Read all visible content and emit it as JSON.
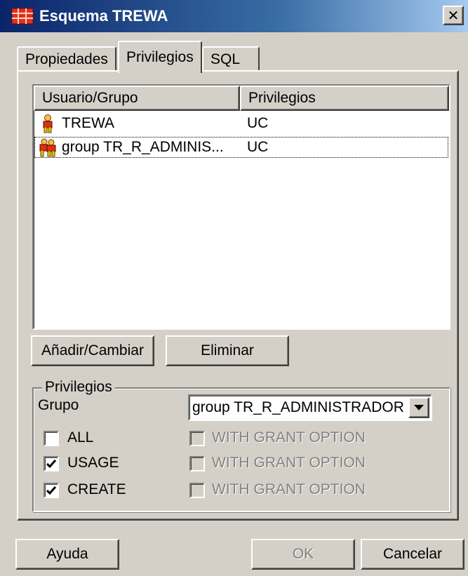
{
  "window": {
    "title": "Esquema TREWA",
    "close_glyph": "✕"
  },
  "tabs": [
    {
      "label": "Propiedades"
    },
    {
      "label": "Privilegios"
    },
    {
      "label": "SQL"
    }
  ],
  "list": {
    "columns": [
      "Usuario/Grupo",
      "Privilegios"
    ],
    "rows": [
      {
        "user": "TREWA",
        "privileges": "UC",
        "icon": "user-icon"
      },
      {
        "user": "group TR_R_ADMINIS...",
        "privileges": "UC",
        "icon": "group-icon"
      }
    ]
  },
  "actions": {
    "add_label": "Añadir/Cambiar",
    "remove_label": "Eliminar"
  },
  "privileges": {
    "legend": "Privilegios",
    "group_label": "Grupo",
    "group_value": "group TR_R_ADMINISTRADOR",
    "items": [
      {
        "label": "ALL",
        "checked": false,
        "grant_label": "WITH GRANT OPTION",
        "grant_checked": false
      },
      {
        "label": "USAGE",
        "checked": true,
        "grant_label": "WITH GRANT OPTION",
        "grant_checked": false
      },
      {
        "label": "CREATE",
        "checked": true,
        "grant_label": "WITH GRANT OPTION",
        "grant_checked": false
      }
    ]
  },
  "footer": {
    "help_label": "Ayuda",
    "ok_label": "OK",
    "cancel_label": "Cancelar"
  },
  "colors": {
    "face": "#d4d0c8",
    "title_start": "#0a246a",
    "title_end": "#a6caf0",
    "disabled_text": "#808080"
  }
}
